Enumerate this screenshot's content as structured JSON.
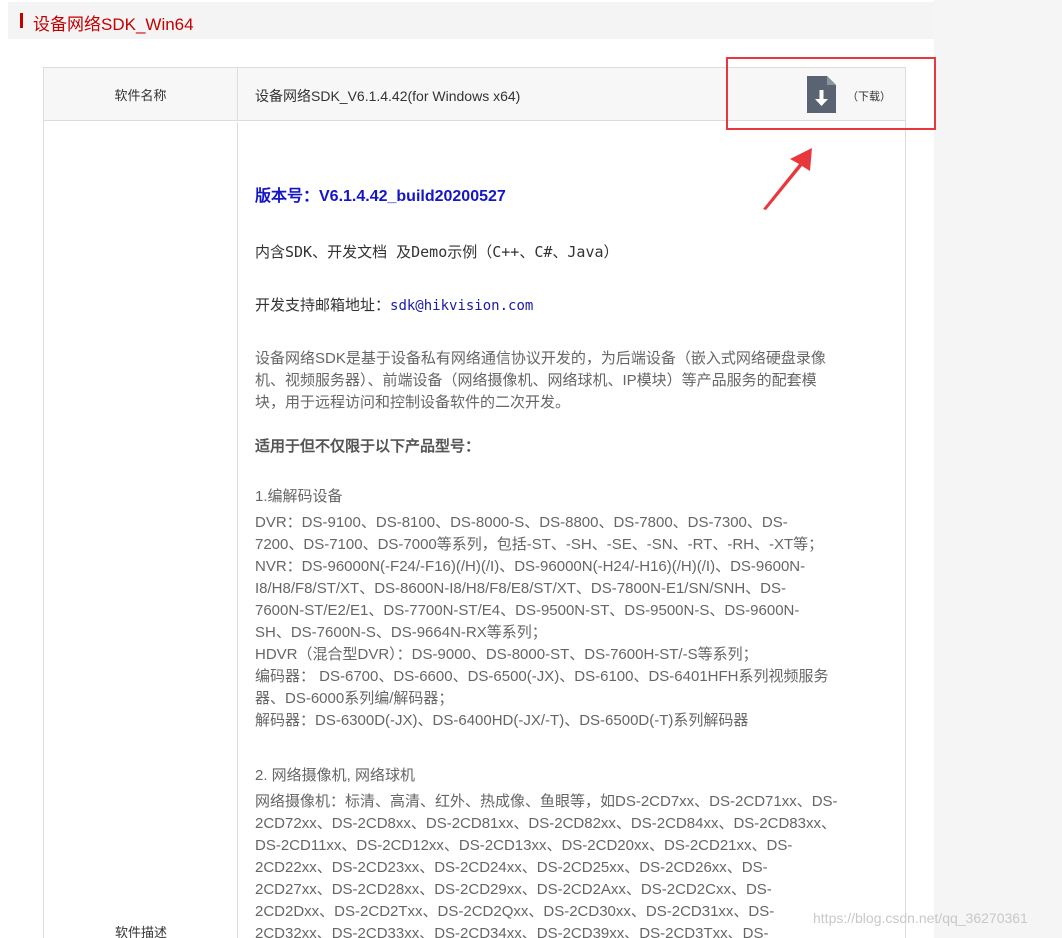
{
  "header": {
    "title": "设备网络SDK_Win64"
  },
  "table": {
    "row1": {
      "label": "软件名称",
      "name": "设备网络SDK_V6.1.4.42(for Windows x64)",
      "download_icon": "file-download-icon",
      "download_label": "（下载）"
    },
    "row2": {
      "label": "软件描述"
    }
  },
  "content": {
    "version": "版本号：V6.1.4.42_build20200527",
    "includes": "内含SDK、开发文档 及Demo示例（C++、C#、Java）",
    "support_label": "开发支持邮箱地址：",
    "support_email": "sdk@hikvision.com",
    "description_lines": [
      "设备网络SDK是基于设备私有网络通信协议开发的，为后端设备（嵌入式网络硬盘录像",
      "机、视频服务器）、前端设备（网络摄像机、网络球机、IP模块）等产品服务的配套模",
      "块，用于远程访问和控制设备软件的二次开发。"
    ],
    "applicable_heading": "适用于但不仅限于以下产品型号：",
    "section1_title": "1.编解码设备",
    "section1_lines": [
      "DVR：DS-9100、DS-8100、DS-8000-S、DS-8800、DS-7800、DS-7300、DS-",
      "7200、DS-7100、DS-7000等系列，包括-ST、-SH、-SE、-SN、-RT、-RH、-XT等；",
      "NVR：DS-96000N(-F24/-F16)(/H)(/I)、DS-96000N(-H24/-H16)(/H)(/I)、DS-9600N-",
      "I8/H8/F8/ST/XT、DS-8600N-I8/H8/F8/E8/ST/XT、DS-7800N-E1/SN/SNH、DS-",
      "7600N-ST/E2/E1、DS-7700N-ST/E4、DS-9500N-ST、DS-9500N-S、DS-9600N-",
      "SH、DS-7600N-S、DS-9664N-RX等系列；",
      "HDVR（混合型DVR）：DS-9000、DS-8000-ST、DS-7600H-ST/-S等系列；",
      "编码器： DS-6700、DS-6600、DS-6500(-JX)、DS-6100、DS-6401HFH系列视频服务",
      "器、DS-6000系列编/解码器；",
      "解码器：DS-6300D(-JX)、DS-6400HD(-JX/-T)、DS-6500D(-T)系列解码器"
    ],
    "section2_title": "2. 网络摄像机, 网络球机",
    "section2_lines": [
      "网络摄像机：标清、高清、红外、热成像、鱼眼等，如DS-2CD7xx、DS-2CD71xx、DS-",
      "2CD72xx、DS-2CD8xx、DS-2CD81xx、DS-2CD82xx、DS-2CD84xx、DS-2CD83xx、",
      "DS-2CD11xx、DS-2CD12xx、DS-2CD13xx、DS-2CD20xx、DS-2CD21xx、DS-",
      "2CD22xx、DS-2CD23xx、DS-2CD24xx、DS-2CD25xx、DS-2CD26xx、DS-",
      "2CD27xx、DS-2CD28xx、DS-2CD29xx、DS-2CD2Axx、DS-2CD2Cxx、DS-",
      "2CD2Dxx、DS-2CD2Txx、DS-2CD2Qxx、DS-2CD30xx、DS-2CD31xx、DS-",
      "2CD32xx、DS-2CD33xx、DS-2CD34xx、DS-2CD39xx、DS-2CD3Txx、DS-"
    ]
  },
  "watermark": "https://blog.csdn.net/qq_36270361",
  "colors": {
    "accent": "#c40000",
    "highlight": "#e8383d",
    "version": "#1515c8"
  }
}
